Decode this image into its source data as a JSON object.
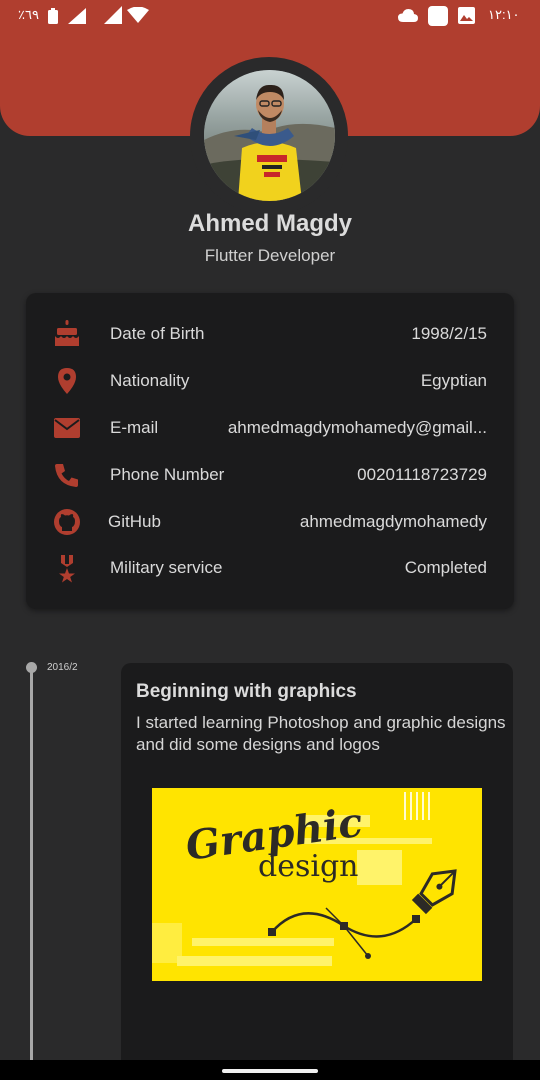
{
  "status_bar": {
    "battery_percent": "٪٦٩",
    "time": "١٢:١٠"
  },
  "profile": {
    "name": "Ahmed Magdy",
    "title": "Flutter Developer"
  },
  "info_rows": [
    {
      "icon": "cake-icon",
      "label": "Date of Birth",
      "value": "1998/2/15"
    },
    {
      "icon": "location-pin-icon",
      "label": "Nationality",
      "value": "Egyptian"
    },
    {
      "icon": "mail-icon",
      "label": "E-mail",
      "value": "ahmedmagdymohamedy@gmail..."
    },
    {
      "icon": "phone-icon",
      "label": "Phone Number",
      "value": "00201118723729"
    },
    {
      "icon": "github-icon",
      "label": "GitHub",
      "value": "ahmedmagdymohamedy"
    },
    {
      "icon": "military-medal-icon",
      "label": "Military service",
      "value": "Completed"
    }
  ],
  "timeline": {
    "date": "2016/2",
    "title": "Beginning with graphics",
    "description": "I started learning Photoshop and graphic designs and did some designs and logos",
    "image_text": {
      "script": "Graphic",
      "word": "design"
    }
  },
  "colors": {
    "accent": "#b03e2f",
    "background": "#2a2a2b",
    "card": "#1b1b1c",
    "image_yellow": "#ffe400"
  }
}
